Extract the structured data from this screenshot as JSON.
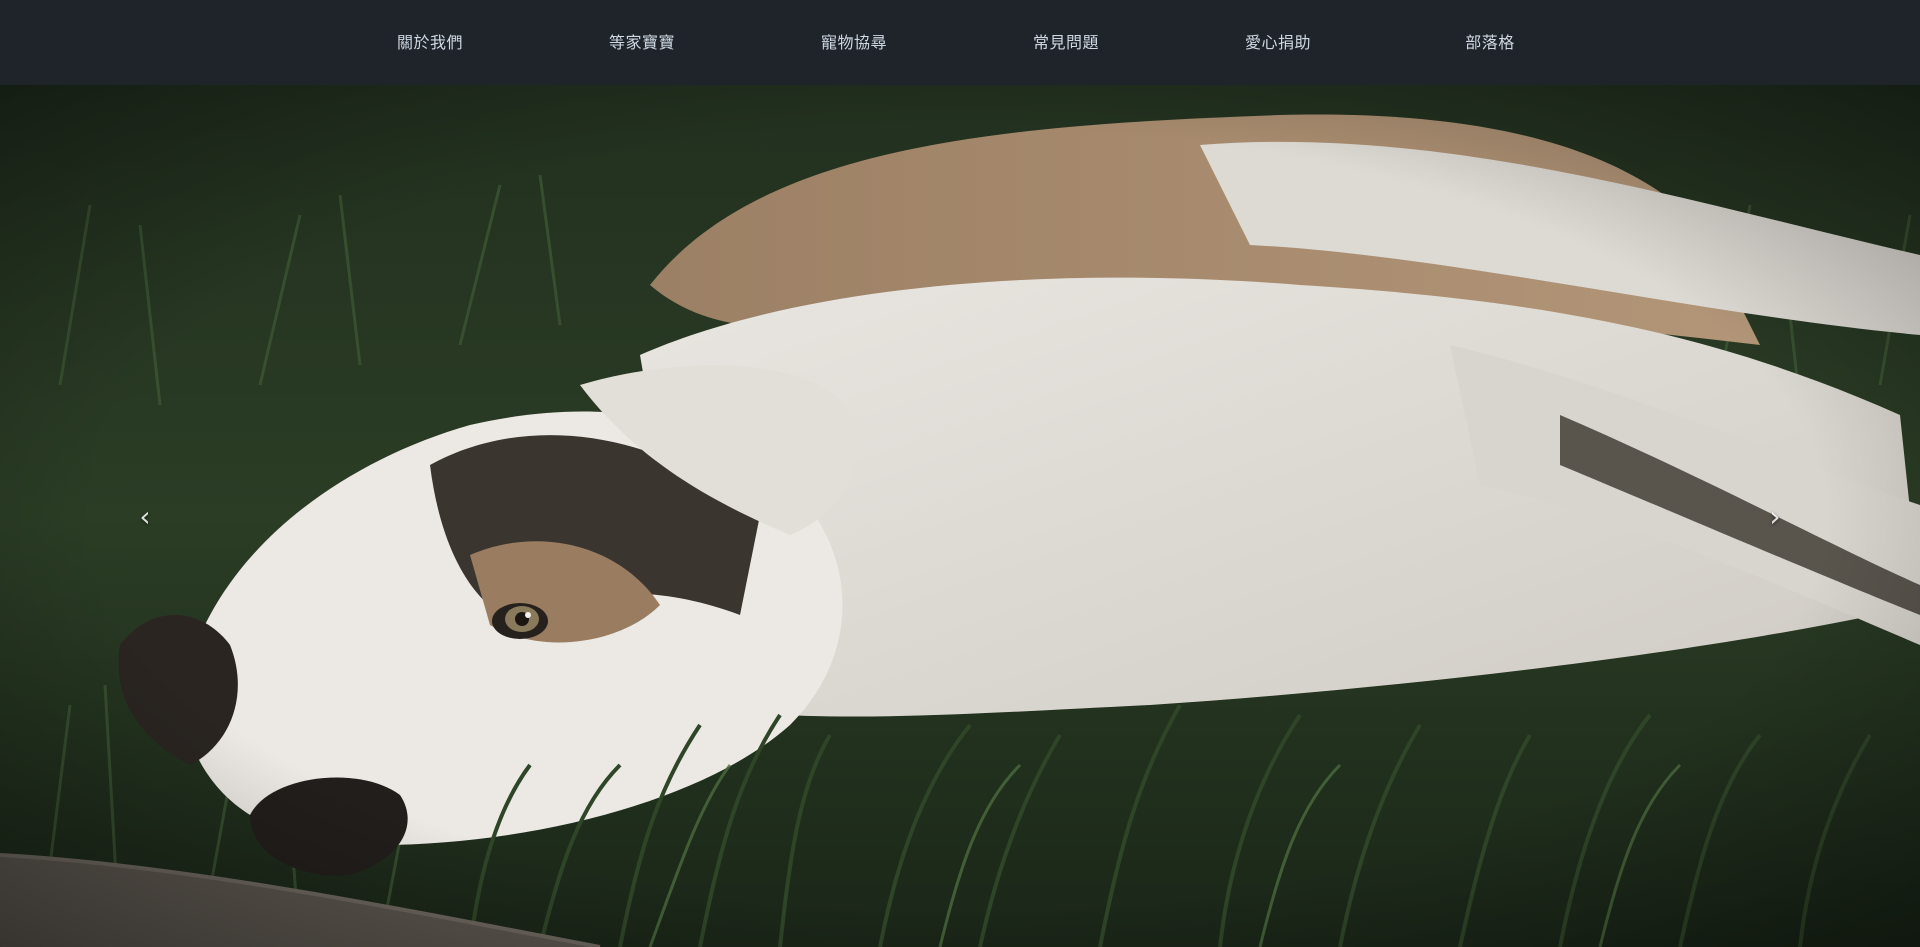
{
  "nav": {
    "items": [
      {
        "label": "關於我們"
      },
      {
        "label": "等家寶寶"
      },
      {
        "label": "寵物協尋"
      },
      {
        "label": "常見問題"
      },
      {
        "label": "愛心捐助"
      },
      {
        "label": "部落格"
      }
    ]
  },
  "carousel": {
    "prev_icon": "‹",
    "next_icon": "›",
    "slide_image": "dog-lying-on-grass"
  },
  "colors": {
    "navbar_bg": "#1f232a",
    "nav_text": "#cfd8e3"
  }
}
